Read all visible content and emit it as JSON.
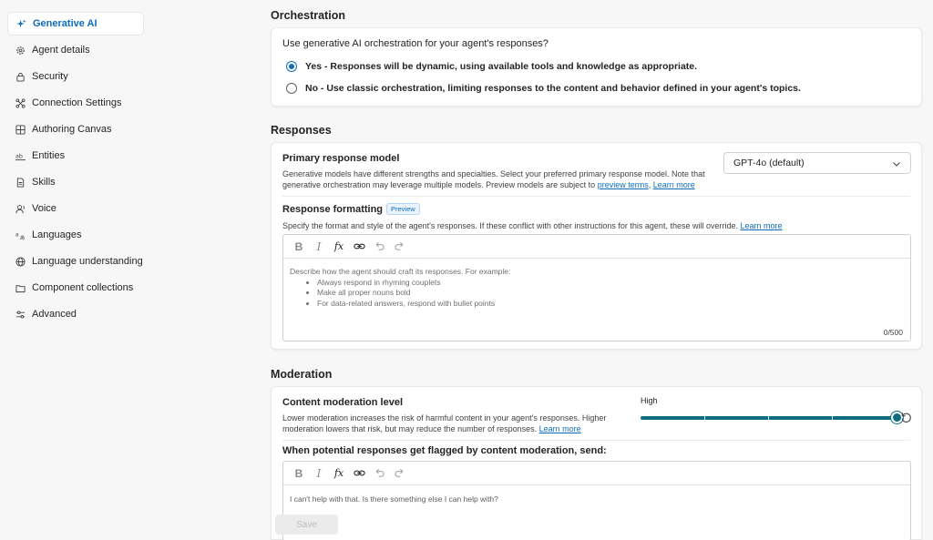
{
  "sidebar": {
    "items": [
      {
        "label": "Generative AI",
        "icon": "sparkle-icon",
        "active": true
      },
      {
        "label": "Agent details",
        "icon": "gear-icon",
        "active": false
      },
      {
        "label": "Security",
        "icon": "lock-icon",
        "active": false
      },
      {
        "label": "Connection Settings",
        "icon": "connection-icon",
        "active": false
      },
      {
        "label": "Authoring Canvas",
        "icon": "grid-icon",
        "active": false
      },
      {
        "label": "Entities",
        "icon": "entities-icon",
        "active": false
      },
      {
        "label": "Skills",
        "icon": "document-icon",
        "active": false
      },
      {
        "label": "Voice",
        "icon": "voice-icon",
        "active": false
      },
      {
        "label": "Languages",
        "icon": "translate-icon",
        "active": false
      },
      {
        "label": "Language understanding",
        "icon": "globe-icon",
        "active": false
      },
      {
        "label": "Component collections",
        "icon": "folder-icon",
        "active": false
      },
      {
        "label": "Advanced",
        "icon": "sliders-icon",
        "active": false
      }
    ]
  },
  "orchestration": {
    "title": "Orchestration",
    "question": "Use generative AI orchestration for your agent's responses?",
    "options": [
      {
        "label": "Yes - Responses will be dynamic, using available tools and knowledge as appropriate.",
        "checked": true
      },
      {
        "label": "No - Use classic orchestration, limiting responses to the content and behavior defined in your agent's topics.",
        "checked": false
      }
    ]
  },
  "responses": {
    "title": "Responses",
    "primary_model": {
      "label": "Primary response model",
      "help_line1": "Generative models have different strengths and specialties. Select your preferred primary response model. Note that",
      "help_line2": "generative orchestration may leverage multiple models. Preview models are subject to",
      "link_terms": "preview terms",
      "link_learn": "Learn more",
      "selected": "GPT-4o (default)"
    },
    "formatting": {
      "label": "Response formatting",
      "badge": "Preview",
      "help": "Specify the format and style of the agent's responses. If these conflict with other instructions for this agent, these will override.",
      "link_learn": "Learn more",
      "placeholder_intro": "Describe how the agent should craft its responses. For example:",
      "placeholder_bullets": [
        "Always respond in rhyming couplets",
        "Make all proper nouns bold",
        "For data-related answers, respond with bullet points"
      ],
      "counter": "0/500"
    }
  },
  "moderation": {
    "title": "Moderation",
    "level": {
      "label": "Content moderation level",
      "help_line1": "Lower moderation increases the risk of harmful content in your agent's responses. Higher",
      "help_line2": "moderation lowers that risk, but may reduce the number of responses.",
      "link_learn": "Learn more",
      "value_label": "High",
      "value_fraction": 1.0
    },
    "flagged": {
      "label": "When potential responses get flagged by content moderation, send:",
      "text": "I can't help with that. Is there something else I can help with?"
    }
  },
  "footer": {
    "save_label": "Save"
  },
  "colors": {
    "accent": "#0f6cbd",
    "slider": "#0f6c81",
    "background": "#f7f7f7"
  }
}
